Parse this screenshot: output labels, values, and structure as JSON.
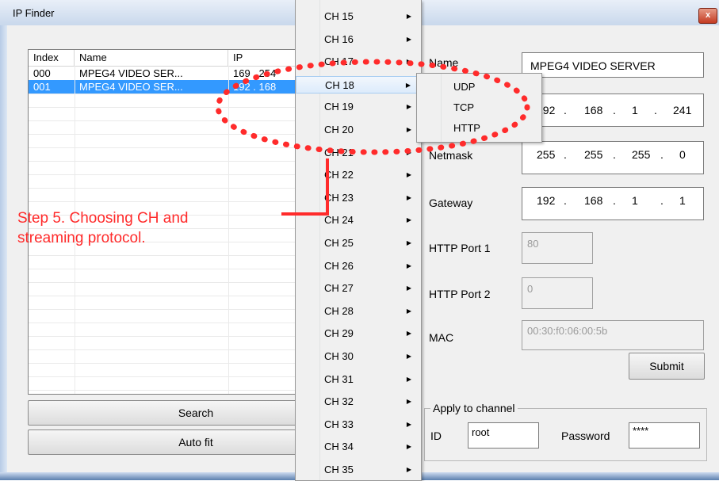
{
  "window": {
    "title": "IP Finder",
    "close": "x"
  },
  "list": {
    "headers": [
      "Index",
      "Name",
      "IP"
    ],
    "rows": [
      {
        "index": "000",
        "name": "MPEG4 VIDEO SER...",
        "ip": "169 . 254"
      },
      {
        "index": "001",
        "name": "MPEG4 VIDEO SER...",
        "ip": "192 . 168"
      }
    ],
    "selected_row": 1
  },
  "buttons": {
    "search": "Search",
    "autofit": "Auto fit",
    "submit": "Submit"
  },
  "form": {
    "name_label": "Name",
    "name_value": "MPEG4 VIDEO SERVER",
    "ip_segments": [
      "192",
      ".",
      "168",
      ".",
      "1",
      ".",
      "241"
    ],
    "netmask_label": "Netmask",
    "netmask_segments": [
      "255",
      ".",
      "255",
      ".",
      "255",
      ".",
      "0"
    ],
    "gateway_label": "Gateway",
    "gateway_segments": [
      "192",
      ".",
      "168",
      ".",
      "1",
      ".",
      "1"
    ],
    "http_port1_label": "HTTP Port 1",
    "http_port1_value": "80",
    "http_port2_label": "HTTP Port 2",
    "http_port2_value": "0",
    "mac_label": "MAC",
    "mac_value": "00:30:f0:06:00:5b"
  },
  "apply": {
    "legend": "Apply to channel",
    "id_label": "ID",
    "id_value": "root",
    "password_label": "Password",
    "password_value": "****"
  },
  "channel_menu": {
    "items": [
      "CH 15",
      "CH 16",
      "CH 17",
      "CH 18",
      "CH 19",
      "CH 20",
      "CH 21",
      "CH 22",
      "CH 23",
      "CH 24",
      "CH 25",
      "CH 26",
      "CH 27",
      "CH 28",
      "CH 29",
      "CH 30",
      "CH 31",
      "CH 32",
      "CH 33",
      "CH 34",
      "CH 35"
    ],
    "highlighted": "CH 18",
    "arrow": "▶"
  },
  "protocol_menu": {
    "items": [
      "UDP",
      "TCP",
      "HTTP"
    ]
  },
  "annotation": {
    "line1": "Step 5. Choosing CH and",
    "line2": "streaming protocol.",
    "color": "#ff2b2b"
  },
  "colors": {
    "selection": "#3399ff",
    "annotation": "#ff2b2b",
    "menu_bg": "#f0f0f0"
  }
}
